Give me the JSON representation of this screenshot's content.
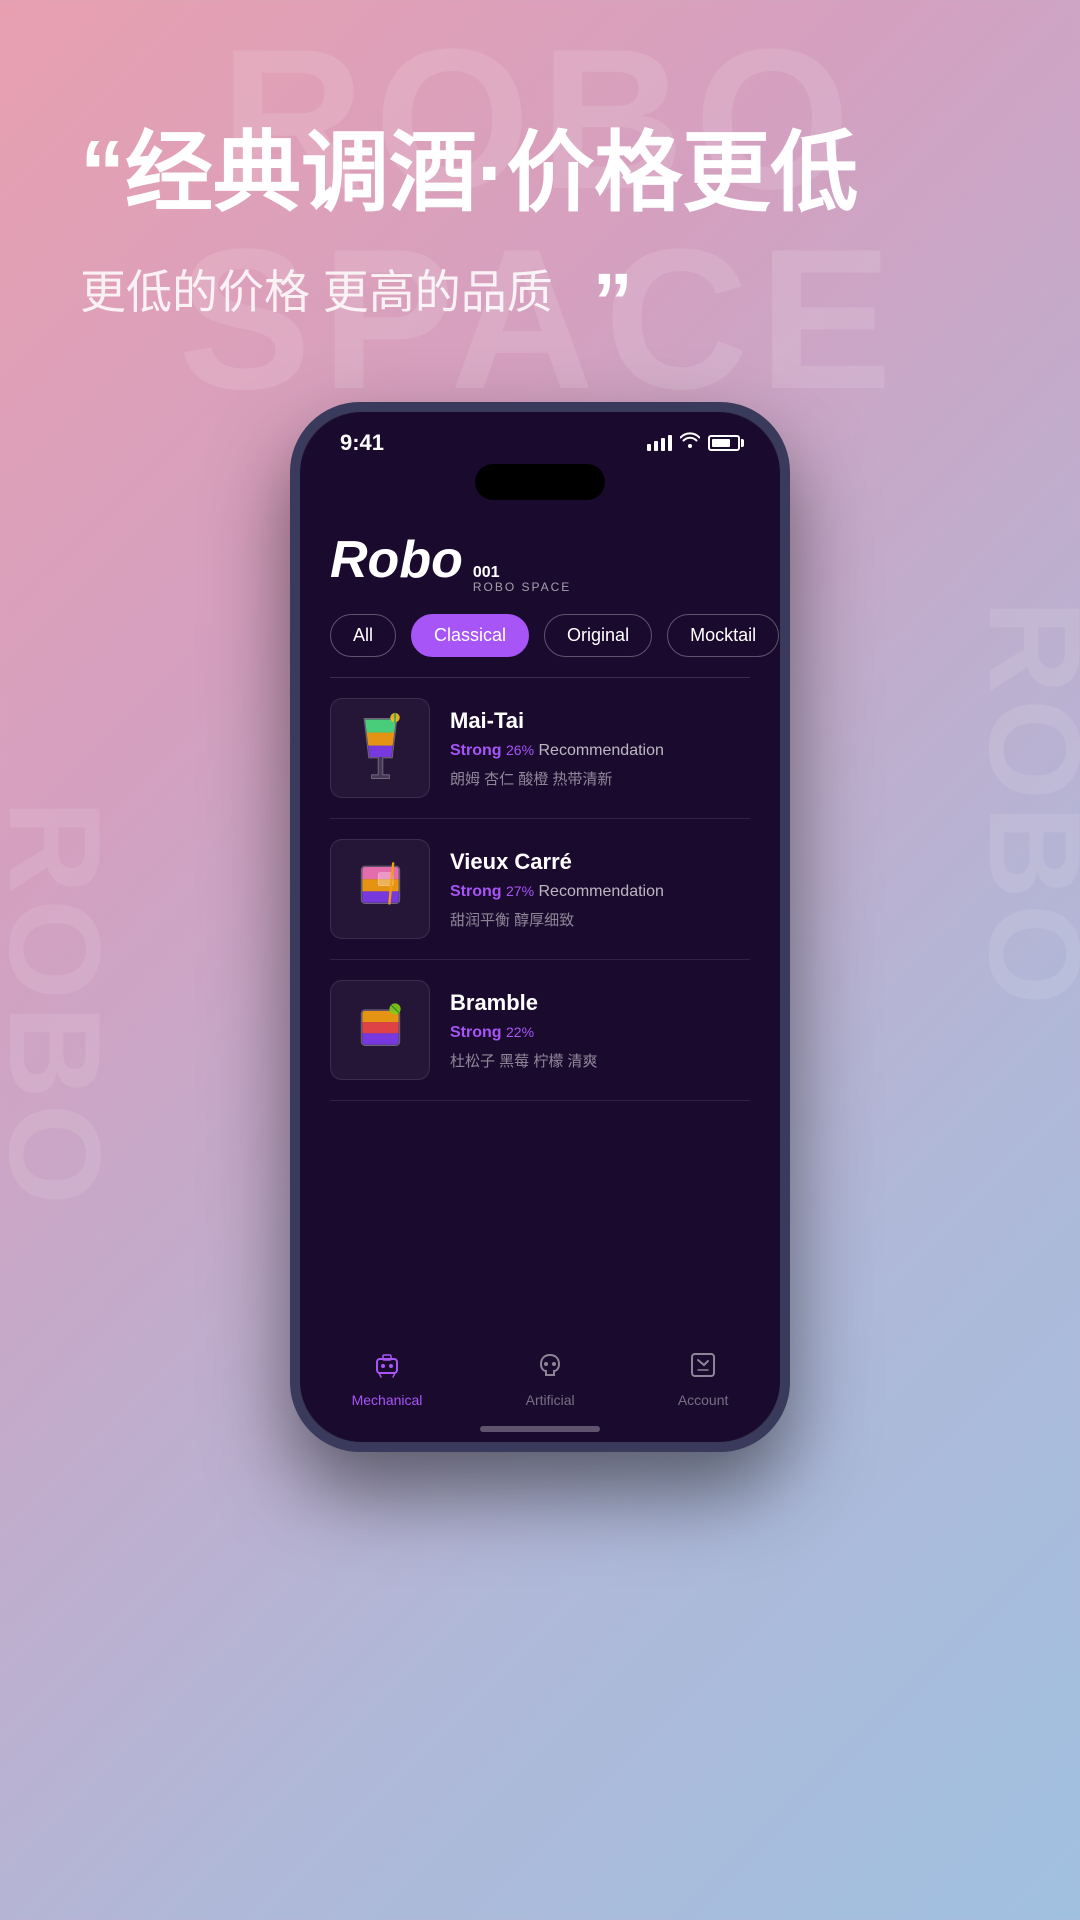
{
  "background": {
    "watermark_top": "ROBO SPACE",
    "watermark_side": "ROBO",
    "watermark_side2": "ROBO"
  },
  "headline": {
    "quote_open": "“",
    "main_text": "经典调酒·价格更低",
    "sub_text": "更低的价格 更高的品质",
    "quote_close": "”"
  },
  "status_bar": {
    "time": "9:41"
  },
  "logo": {
    "text": "Robo",
    "number": "001",
    "subtitle": "ROBO SPACE"
  },
  "filter_tabs": [
    {
      "label": "All",
      "active": false
    },
    {
      "label": "Classical",
      "active": true
    },
    {
      "label": "Original",
      "active": false
    },
    {
      "label": "Mocktail",
      "active": false
    }
  ],
  "cocktails": [
    {
      "name": "Mai-Tai",
      "strength": "Strong",
      "percent": "26%",
      "recommendation": "Recommendation",
      "tags": "朗姆 杏仁 酸橙 热带清新",
      "color1": "#4ade80",
      "color2": "#f59e0b",
      "color3": "#7c3aed"
    },
    {
      "name": "Vieux Carré",
      "strength": "Strong",
      "percent": "27%",
      "recommendation": "Recommendation",
      "tags": "甜润平衡 醇厚细致",
      "color1": "#f472b6",
      "color2": "#f59e0b",
      "color3": "#7c3aed"
    },
    {
      "name": "Bramble",
      "strength": "Strong",
      "percent": "22%",
      "recommendation": "",
      "tags": "杜松子 黑莓 柠檬 清爽",
      "color1": "#f59e0b",
      "color2": "#ef4444",
      "color3": "#7c3aed"
    }
  ],
  "bottom_nav": [
    {
      "label": "Mechanical",
      "active": true,
      "icon": "robot"
    },
    {
      "label": "Artificial",
      "active": false,
      "icon": "bell"
    },
    {
      "label": "Account",
      "active": false,
      "icon": "account"
    }
  ]
}
